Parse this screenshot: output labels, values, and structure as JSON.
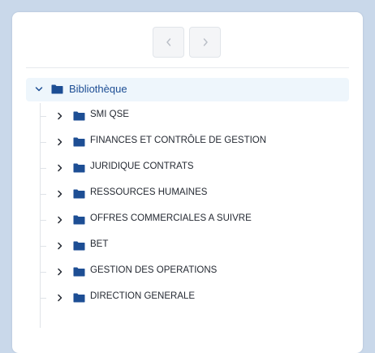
{
  "pager": {
    "prev_icon": "chevron-left-icon",
    "next_icon": "chevron-right-icon"
  },
  "tree": {
    "root": {
      "label": "Bibliothèque",
      "icon": "folder-icon",
      "expanded": true
    },
    "children": [
      {
        "label": "SMI QSE"
      },
      {
        "label": "FINANCES ET CONTRÔLE DE GESTION"
      },
      {
        "label": "JURIDIQUE CONTRATS"
      },
      {
        "label": "RESSOURCES HUMAINES"
      },
      {
        "label": "OFFRES COMMERCIALES A SUIVRE"
      },
      {
        "label": "BET"
      },
      {
        "label": "GESTION DES OPERATIONS"
      },
      {
        "label": "DIRECTION GENERALE"
      }
    ]
  },
  "colors": {
    "folder": "#1d4e94",
    "root_highlight": "#eef6fc",
    "text": "#252a33"
  }
}
